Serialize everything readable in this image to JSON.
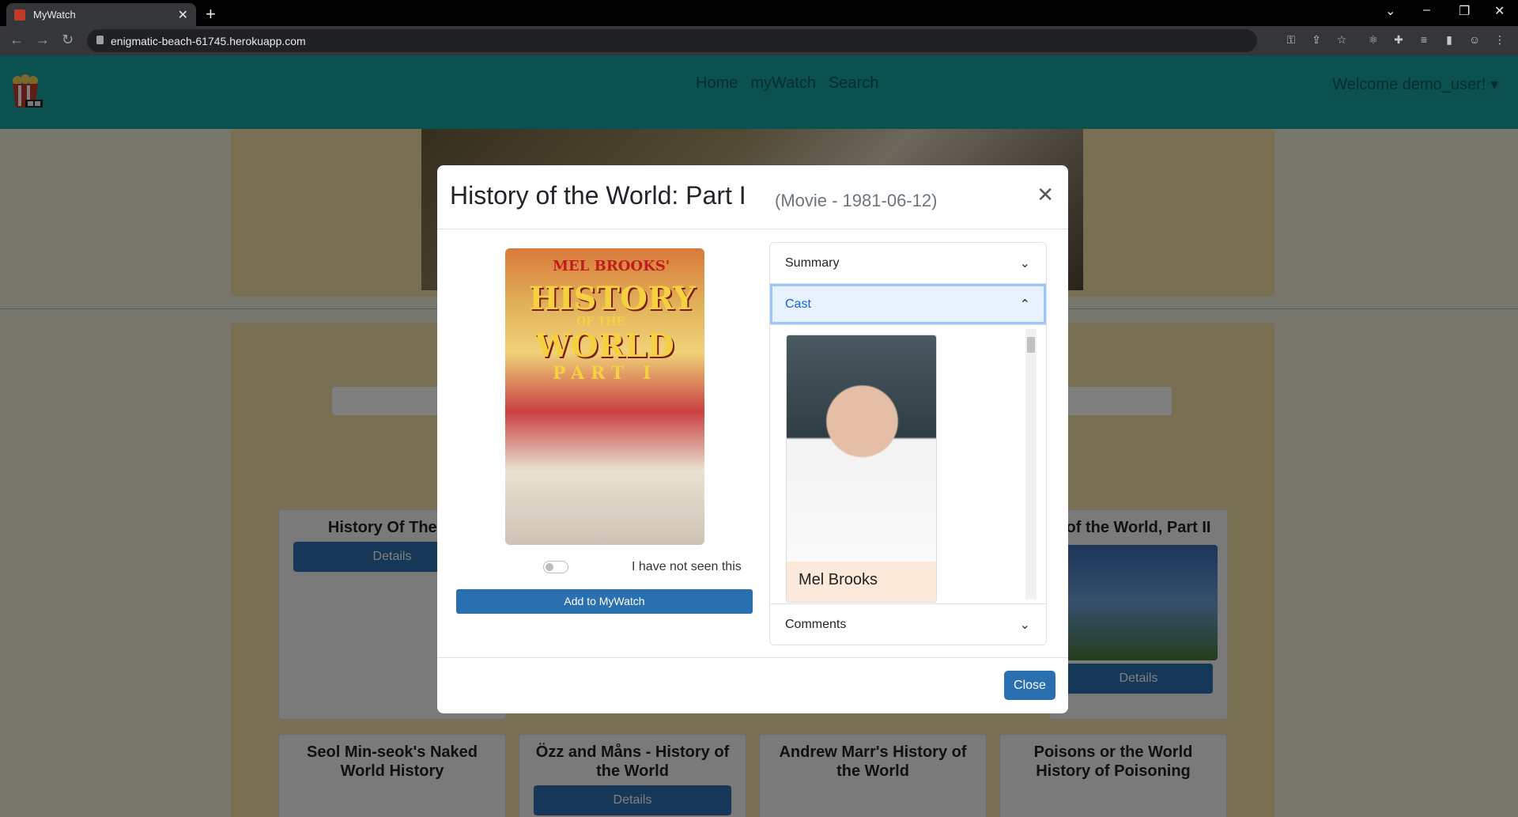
{
  "browser": {
    "tab_title": "MyWatch",
    "new_tab": "+",
    "url": "enigmatic-beach-61745.herokuapp.com"
  },
  "appnav": {
    "links": [
      "Home",
      "myWatch",
      "Search"
    ],
    "welcome": "Welcome demo_user!"
  },
  "cards": [
    {
      "title": "History Of The W",
      "button": "Details"
    },
    {
      "title": "of the World, Part II",
      "button": "Details"
    },
    {
      "title": "Seol Min-seok's Naked World History",
      "button": ""
    },
    {
      "title": "Özz and Måns - History of the World",
      "button": "Details"
    },
    {
      "title": "Andrew Marr's History of the World",
      "button": ""
    },
    {
      "title": "Poisons or the World History of Poisoning",
      "button": ""
    }
  ],
  "modal": {
    "title": "History of the World: Part I",
    "subtitle": "(Movie - 1981-06-12)",
    "poster_text": {
      "line1": "MEL BROOKS'",
      "line2": "HISTORY",
      "line3": "OF THE",
      "line4": "WORLD",
      "line5": "PART I"
    },
    "seen_label": "I have not seen this",
    "add_button": "Add to MyWatch",
    "accordion": {
      "summary": "Summary",
      "cast": "Cast",
      "comments": "Comments"
    },
    "cast": [
      {
        "name": "Mel Brooks"
      }
    ],
    "close_button": "Close"
  }
}
